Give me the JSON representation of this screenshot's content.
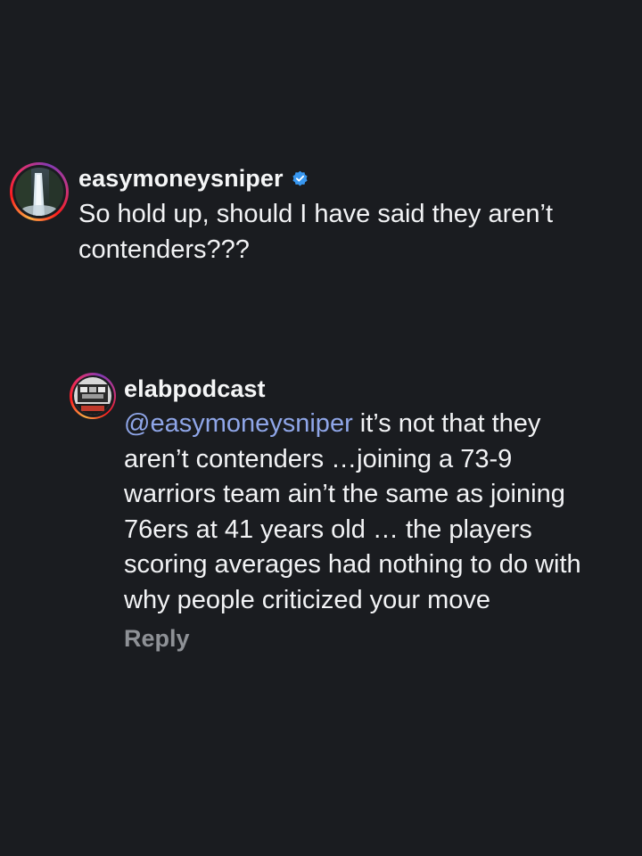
{
  "comments": [
    {
      "username": "easymoneysniper",
      "verified": true,
      "text": "So hold up, should I have said they aren’t contenders???",
      "avatar": "waterfall-avatar"
    },
    {
      "username": "elabpodcast",
      "verified": false,
      "mention": "@easymoneysniper",
      "text": " it’s not that they aren’t contenders …joining a 73-9 warriors team ain’t the same as joining 76ers at 41 years old … the players scoring averages had nothing to do with why people criticized your move",
      "reply_label": "Reply",
      "avatar": "podcast-logo-avatar"
    }
  ],
  "colors": {
    "background": "#1a1c20",
    "mention": "#8fa6e8",
    "verified_badge": "#3897f0",
    "reply": "#8e9196"
  }
}
